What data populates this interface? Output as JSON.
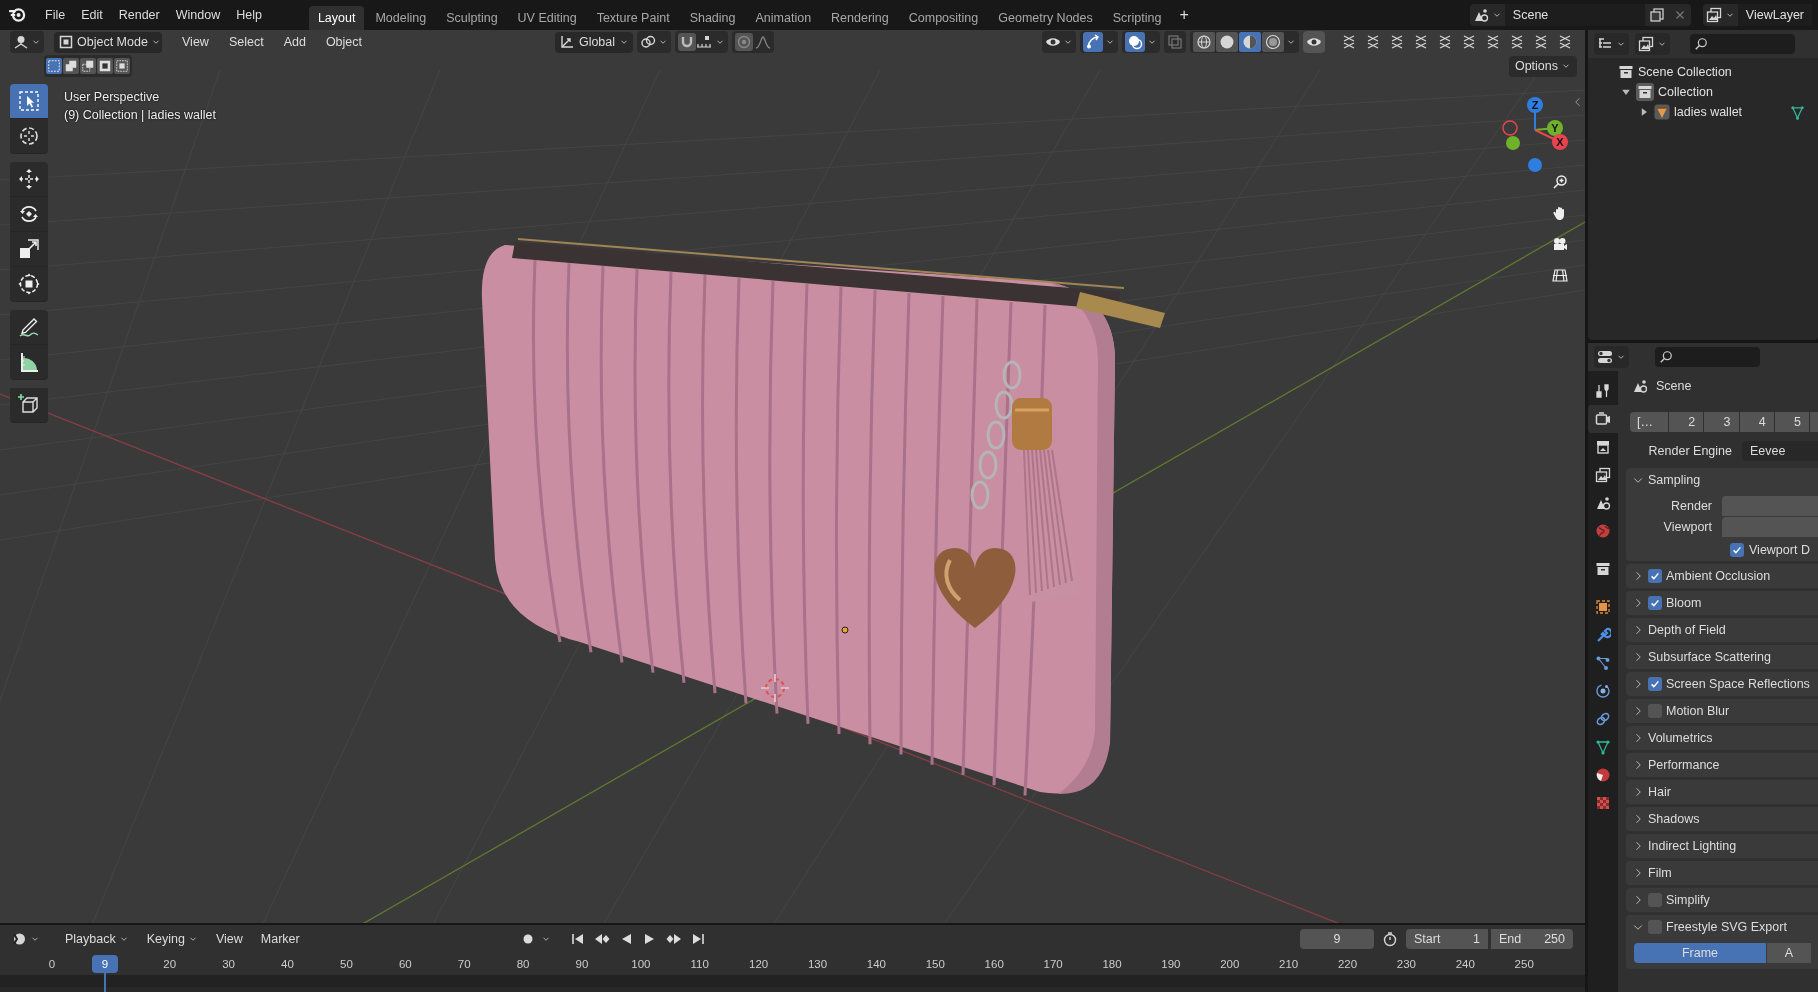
{
  "menu": [
    "File",
    "Edit",
    "Render",
    "Window",
    "Help"
  ],
  "workspaces": [
    {
      "label": "Layout",
      "selected": true
    },
    {
      "label": "Modeling",
      "selected": false
    },
    {
      "label": "Sculpting",
      "selected": false
    },
    {
      "label": "UV Editing",
      "selected": false
    },
    {
      "label": "Texture Paint",
      "selected": false
    },
    {
      "label": "Shading",
      "selected": false
    },
    {
      "label": "Animation",
      "selected": false
    },
    {
      "label": "Rendering",
      "selected": false
    },
    {
      "label": "Compositing",
      "selected": false
    },
    {
      "label": "Geometry Nodes",
      "selected": false
    },
    {
      "label": "Scripting",
      "selected": false
    }
  ],
  "add_workspace": "+",
  "scene": "Scene",
  "view_layer": "ViewLayer",
  "viewport": {
    "mode": "Object Mode",
    "menus": [
      "View",
      "Select",
      "Add",
      "Object"
    ],
    "orientation": "Global",
    "gizmos_on": true,
    "overlays_on": true,
    "shading": [
      {
        "kind": "wireframe",
        "selected": false
      },
      {
        "kind": "solid",
        "selected": false
      },
      {
        "kind": "material",
        "selected": true
      },
      {
        "kind": "rendered",
        "selected": false
      }
    ],
    "options": "Options",
    "view_name": "User Perspective",
    "object_info": "(9) Collection | ladies wallet",
    "axes": [
      {
        "label": "Z",
        "color": "#2e7ee0"
      },
      {
        "label": "Y",
        "color": "#6fb22a"
      },
      {
        "label": "X",
        "color": "#e8434f"
      }
    ]
  },
  "tools": [
    {
      "kind": "select-box",
      "selected": true
    },
    {
      "kind": "cursor",
      "selected": false
    },
    {
      "kind": "move",
      "selected": false
    },
    {
      "kind": "rotate",
      "selected": false
    },
    {
      "kind": "scale",
      "selected": false
    },
    {
      "kind": "transform",
      "selected": false
    },
    {
      "kind": "annotate",
      "selected": false
    },
    {
      "kind": "measure",
      "selected": false
    },
    {
      "kind": "add-cube",
      "selected": false
    }
  ],
  "outliner": {
    "items": [
      {
        "label": "Scene Collection",
        "kind": "scene-collection",
        "children": [
          {
            "label": "Collection",
            "kind": "collection",
            "expanded": true,
            "children": [
              {
                "label": "ladies wallet",
                "kind": "mesh-object",
                "expanded": false
              }
            ]
          }
        ]
      }
    ]
  },
  "properties": {
    "tabs": [
      {
        "kind": "tool",
        "selected": false
      },
      {
        "kind": "render",
        "selected": true
      },
      {
        "kind": "output",
        "selected": false
      },
      {
        "kind": "view-layer",
        "selected": false
      },
      {
        "kind": "scene",
        "selected": false
      },
      {
        "kind": "world",
        "selected": false
      },
      {
        "kind": "collection",
        "selected": false
      },
      {
        "kind": "object",
        "selected": false
      },
      {
        "kind": "modifier",
        "selected": false
      },
      {
        "kind": "particles",
        "selected": false
      },
      {
        "kind": "physics",
        "selected": false
      },
      {
        "kind": "constraint",
        "selected": false
      },
      {
        "kind": "data",
        "selected": false
      },
      {
        "kind": "material",
        "selected": false
      },
      {
        "kind": "texture",
        "selected": false
      }
    ],
    "title": "Scene",
    "layers": [
      "[…",
      "2",
      "3",
      "4",
      "5"
    ],
    "render_engine": {
      "label": "Render Engine",
      "value": "Eevee"
    },
    "sampling": {
      "label": "Sampling",
      "expanded": true,
      "fields": [
        "Render",
        "Viewport"
      ],
      "checkbox": {
        "label": "Viewport D",
        "checked": true
      }
    },
    "sections": [
      {
        "label": "Ambient Occlusion",
        "kind": "checkbox",
        "checked": true,
        "expanded": false
      },
      {
        "label": "Bloom",
        "kind": "checkbox",
        "checked": true,
        "expanded": false
      },
      {
        "label": "Depth of Field",
        "kind": "plain",
        "expanded": false
      },
      {
        "label": "Subsurface Scattering",
        "kind": "plain",
        "expanded": false
      },
      {
        "label": "Screen Space Reflections",
        "kind": "checkbox",
        "checked": true,
        "expanded": false
      },
      {
        "label": "Motion Blur",
        "kind": "checkbox",
        "checked": false,
        "expanded": false
      },
      {
        "label": "Volumetrics",
        "kind": "plain",
        "expanded": false
      },
      {
        "label": "Performance",
        "kind": "plain",
        "expanded": false
      },
      {
        "label": "Hair",
        "kind": "plain",
        "expanded": false
      },
      {
        "label": "Shadows",
        "kind": "plain",
        "expanded": false
      },
      {
        "label": "Indirect Lighting",
        "kind": "plain",
        "expanded": false
      },
      {
        "label": "Film",
        "kind": "plain",
        "expanded": false
      },
      {
        "label": "Simplify",
        "kind": "checkbox",
        "checked": false,
        "expanded": false
      },
      {
        "label": "Freestyle SVG Export",
        "kind": "checkbox",
        "checked": false,
        "expanded": true,
        "modes": [
          {
            "label": "Frame",
            "selected": true
          },
          {
            "label": "A",
            "selected": false
          }
        ]
      }
    ]
  },
  "timeline": {
    "menus": [
      {
        "label": "Playback",
        "dropdown": true
      },
      {
        "label": "Keying",
        "dropdown": true
      },
      {
        "label": "View",
        "dropdown": false
      },
      {
        "label": "Marker",
        "dropdown": false
      }
    ],
    "auto_keying": false,
    "current_frame": "9",
    "start": {
      "label": "Start",
      "value": "1"
    },
    "end": {
      "label": "End",
      "value": "250"
    },
    "playhead": "9",
    "ticks": [
      "0",
      "20",
      "30",
      "40",
      "50",
      "60",
      "70",
      "80",
      "90",
      "100",
      "110",
      "120",
      "130",
      "140",
      "150",
      "160",
      "170",
      "180",
      "190",
      "200",
      "210",
      "220",
      "230",
      "240",
      "250"
    ]
  }
}
